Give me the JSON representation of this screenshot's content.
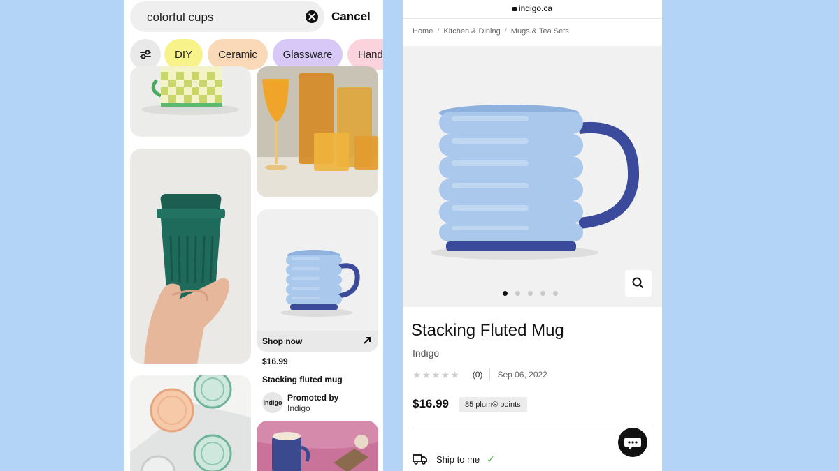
{
  "search": {
    "query": "colorful cups",
    "cancel_label": "Cancel"
  },
  "filter_chips": [
    {
      "label": "DIY",
      "color": "#f7f38a"
    },
    {
      "label": "Ceramic",
      "color": "#f9d9b8"
    },
    {
      "label": "Glassware",
      "color": "#d7c8f7"
    },
    {
      "label": "Hand",
      "color": "#fbd3dd"
    }
  ],
  "promoted_pin": {
    "shop_label": "Shop now",
    "price": "$16.99",
    "title": "Stacking fluted mug",
    "promoted_by": "Promoted by",
    "advertiser": "Indigo",
    "avatar_text": "Indigo"
  },
  "browser": {
    "url": "indigo.ca"
  },
  "breadcrumb": [
    "Home",
    "Kitchen & Dining",
    "Mugs & Tea Sets"
  ],
  "gallery": {
    "image_count": 5,
    "active_index": 0
  },
  "product": {
    "title": "Stacking Fluted Mug",
    "brand": "Indigo",
    "stars": "★★★★★",
    "rating": 0,
    "review_count": "(0)",
    "date": "Sep 06, 2022",
    "price": "$16.99",
    "points": "85 plum® points",
    "shipping_option": "Ship to me",
    "check_mark": "✓"
  },
  "colors": {
    "background": "#b3d4f7",
    "mug_blue": "#a9c8ec",
    "mug_handle": "#3c4a9c",
    "travel_cup_green": "#1f6b5b"
  }
}
